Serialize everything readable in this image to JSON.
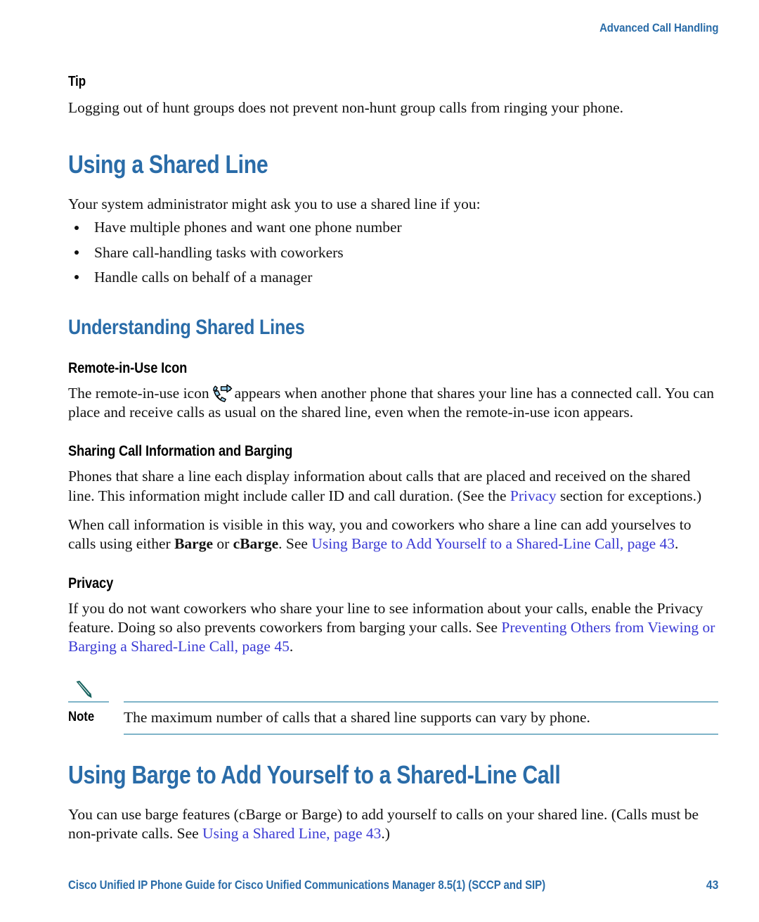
{
  "header": {
    "running_head": "Advanced Call Handling"
  },
  "tip": {
    "label": "Tip",
    "text": "Logging out of hunt groups does not prevent non-hunt group calls from ringing your phone."
  },
  "chapter": {
    "title": "Using a Shared Line",
    "intro": "Your system administrator might ask you to use a shared line if you:",
    "bullets": [
      "Have multiple phones and want one phone number",
      "Share call-handling tasks with coworkers",
      "Handle calls on behalf of a manager"
    ]
  },
  "section_understanding": {
    "title": "Understanding Shared Lines",
    "remote_in_use": {
      "heading": "Remote-in-Use Icon",
      "text_before_icon": "The remote-in-use icon",
      "icon_name": "remote-in-use-phone-icon",
      "icon_color": "#9dd4f0",
      "text_after_icon": "appears when another phone that shares your line has a connected call. You can place and receive calls as usual on the shared line, even when the remote-in-use icon appears."
    },
    "sharing": {
      "heading": "Sharing Call Information and Barging",
      "paragraph1_part1": "Phones that share a line each display information about calls that are placed and received on the shared line. This information might include caller ID and call duration. (See the ",
      "paragraph1_link": "Privacy",
      "paragraph1_part2": " section for exceptions.)",
      "paragraph2_part1": "When call information is visible in this way, you and coworkers who share a line can add yourselves to calls using either ",
      "paragraph2_bold1": "Barge",
      "paragraph2_mid": " or ",
      "paragraph2_bold2": "cBarge",
      "paragraph2_part2": ". See ",
      "paragraph2_link": "Using Barge to Add Yourself to a Shared-Line Call, page 43",
      "paragraph2_end": "."
    },
    "privacy": {
      "heading": "Privacy",
      "paragraph_part1": "If you do not want coworkers who share your line to see information about your calls, enable the Privacy feature. Doing so also prevents coworkers from barging your calls. See ",
      "paragraph_link": "Preventing Others from Viewing or Barging a Shared-Line Call, page 45",
      "paragraph_part2": "."
    }
  },
  "note": {
    "icon_name": "pencil-note-icon",
    "icon_color": "#14605c",
    "rule_color": "#7fb4c9",
    "label": "Note",
    "text": "The maximum number of calls that a shared line supports can vary by phone."
  },
  "section_barge": {
    "title": "Using Barge to Add Yourself to a Shared-Line Call",
    "paragraph_part1": "You can use barge features (cBarge or Barge) to add yourself to calls on your shared line. (Calls must be non-private calls. See ",
    "paragraph_link": "Using a Shared Line, page 43",
    "paragraph_part2": ".)"
  },
  "footer": {
    "title": "Cisco Unified IP Phone Guide for Cisco Unified Communications Manager 8.5(1) (SCCP and SIP)",
    "page_number": "43"
  },
  "colors": {
    "heading_blue": "#2a6ca8",
    "link_blue": "#3a3ad4",
    "note_rule": "#7fb4c9",
    "note_icon_teal": "#14605c",
    "remote_icon_blue": "#9dd4f0"
  }
}
